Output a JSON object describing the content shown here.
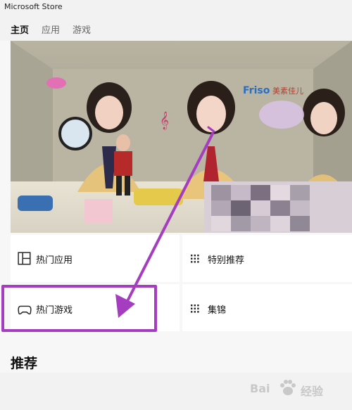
{
  "window": {
    "title": "Microsoft Store"
  },
  "nav": {
    "tabs": [
      {
        "label": "主页",
        "active": true
      },
      {
        "label": "应用",
        "active": false
      },
      {
        "label": "游戏",
        "active": false
      }
    ]
  },
  "banner": {
    "logo_text": "Friso",
    "logo_sub": "美素佳儿"
  },
  "tiles": [
    {
      "label": "热门应用",
      "icon": "grid-layout-icon"
    },
    {
      "label": "特别推荐",
      "icon": "dots-grid-icon"
    },
    {
      "label": "热门游戏",
      "icon": "gamepad-icon"
    },
    {
      "label": "集锦",
      "icon": "dots-grid-icon"
    }
  ],
  "section": {
    "title": "推荐"
  },
  "watermark": {
    "brand": "Bai",
    "brand2": "经验",
    "brand_icon": "paw-icon"
  },
  "colors": {
    "accent_annotation": "#a53dc0",
    "background": "#f2f2f2",
    "tile": "#ffffff"
  }
}
